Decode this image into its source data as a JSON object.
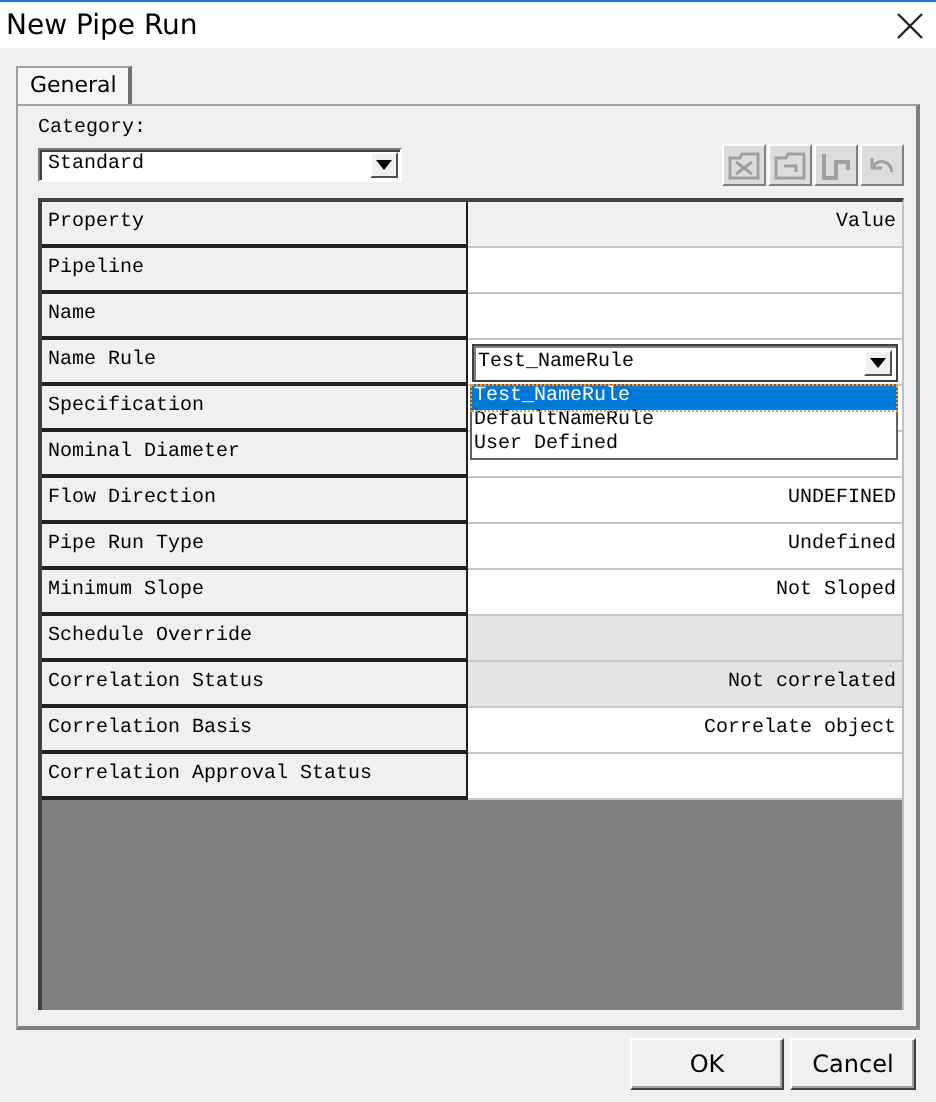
{
  "window": {
    "title": "New Pipe Run"
  },
  "tabs": [
    {
      "label": "General",
      "selected": true
    }
  ],
  "category": {
    "label": "Category:",
    "value": "Standard"
  },
  "toolbar": [
    {
      "kind": "delete",
      "disabled": true
    },
    {
      "kind": "folder",
      "disabled": true
    },
    {
      "kind": "pipe",
      "disabled": true
    },
    {
      "kind": "undo",
      "disabled": true
    }
  ],
  "grid": {
    "columns": [
      "Property",
      "Value"
    ],
    "rows": [
      {
        "property": "Pipeline",
        "readonly": false
      },
      {
        "property": "Name",
        "readonly": false
      },
      {
        "property": "Name Rule",
        "readonly": false,
        "kind": "dropdown",
        "value": "Test_NameRule",
        "expanded": true,
        "options": [
          {
            "label": "Test_NameRule",
            "selected": true
          },
          {
            "label": "DefaultNameRule",
            "selected": false
          },
          {
            "label": "User Defined",
            "selected": false
          }
        ]
      },
      {
        "property": "Specification",
        "readonly": false
      },
      {
        "property": "Nominal Diameter",
        "readonly": false
      },
      {
        "property": "Flow Direction",
        "value": "UNDEFINED",
        "readonly": false
      },
      {
        "property": "Pipe Run Type",
        "value": "Undefined",
        "readonly": false
      },
      {
        "property": "Minimum Slope",
        "value": "Not Sloped",
        "readonly": false
      },
      {
        "property": "Schedule Override",
        "readonly": true
      },
      {
        "property": "Correlation Status",
        "value": "Not correlated",
        "readonly": true
      },
      {
        "property": "Correlation Basis",
        "value": "Correlate object",
        "readonly": false
      },
      {
        "property": "Correlation Approval Status",
        "readonly": false
      }
    ]
  },
  "buttons": [
    {
      "label": "OK"
    },
    {
      "label": "Cancel"
    }
  ]
}
